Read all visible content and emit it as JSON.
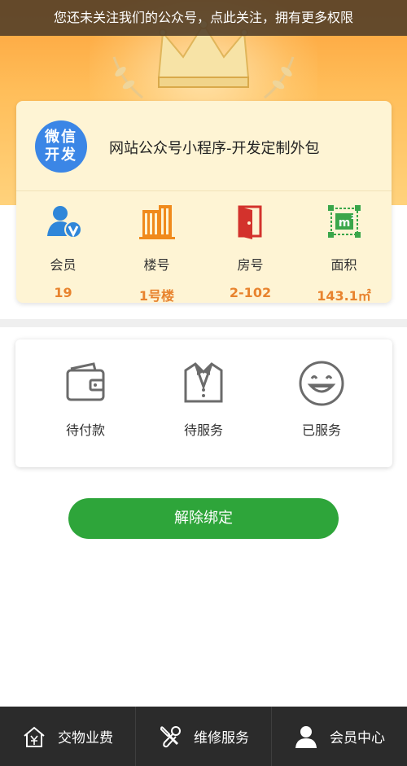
{
  "notice": {
    "text": "您还未关注我们的公众号，点此关注，拥有更多权限"
  },
  "member_card": {
    "logo_text": "微信开发",
    "site_name": "网站公众号小程序-开发定制外包",
    "stats": [
      {
        "label": "会员",
        "value": "19",
        "icon": "member-v-icon",
        "color": "#2f86d9"
      },
      {
        "label": "楼号",
        "value": "1号楼",
        "icon": "building-icon",
        "color": "#f08a1c"
      },
      {
        "label": "房号",
        "value": "2-102",
        "icon": "door-icon",
        "color": "#d3322c"
      },
      {
        "label": "面积",
        "value": "143.1㎡",
        "icon": "area-m2-icon",
        "color": "#3aa64a"
      }
    ]
  },
  "orders": [
    {
      "label": "待付款",
      "icon": "wallet-icon"
    },
    {
      "label": "待服务",
      "icon": "tuxedo-icon"
    },
    {
      "label": "已服务",
      "icon": "smile-icon"
    }
  ],
  "unbind_label": "解除绑定",
  "tabbar": [
    {
      "label": "交物业费",
      "icon": "house-yen-icon"
    },
    {
      "label": "维修服务",
      "icon": "wrench-icon"
    },
    {
      "label": "会员中心",
      "icon": "user-icon"
    }
  ],
  "colors": {
    "accent_orange": "#e8832e",
    "primary_green": "#2ea53a",
    "tabbar_bg": "#2b2b2b"
  }
}
